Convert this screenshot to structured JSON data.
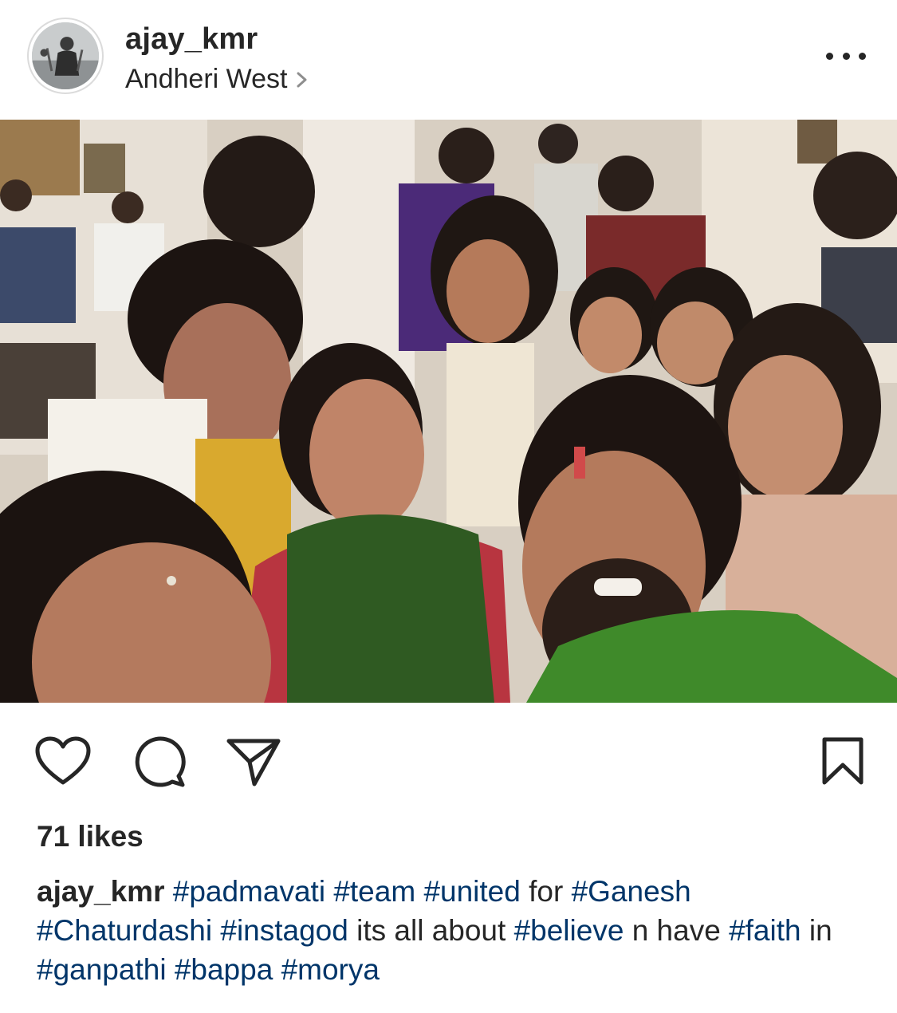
{
  "post": {
    "username": "ajay_kmr",
    "location": "Andheri West",
    "likes": "71 likes"
  },
  "caption": {
    "username": "ajay_kmr",
    "parts": [
      {
        "t": "#padmavati",
        "tag": true
      },
      {
        "t": " ",
        "tag": false
      },
      {
        "t": "#team",
        "tag": true
      },
      {
        "t": " ",
        "tag": false
      },
      {
        "t": "#united",
        "tag": true
      },
      {
        "t": " for ",
        "tag": false
      },
      {
        "t": "#Ganesh",
        "tag": true
      },
      {
        "t": " ",
        "tag": false
      },
      {
        "t": "#Chaturdashi",
        "tag": true
      },
      {
        "t": " ",
        "tag": false
      },
      {
        "t": "#instagod",
        "tag": true
      },
      {
        "t": " its all about ",
        "tag": false
      },
      {
        "t": "#believe",
        "tag": true
      },
      {
        "t": " n have ",
        "tag": false
      },
      {
        "t": "#faith",
        "tag": true
      },
      {
        "t": " in ",
        "tag": false
      },
      {
        "t": "#ganpathi",
        "tag": true
      },
      {
        "t": " ",
        "tag": false
      },
      {
        "t": "#bappa",
        "tag": true
      },
      {
        "t": " ",
        "tag": false
      },
      {
        "t": "#morya",
        "tag": true
      }
    ]
  },
  "icons": {
    "more": "more-options-icon",
    "like": "heart-icon",
    "comment": "comment-icon",
    "share": "paper-plane-icon",
    "save": "bookmark-icon",
    "location_chevron": "chevron-right-icon"
  },
  "colors": {
    "text": "#262626",
    "hashtag": "#003569",
    "divider": "#dbdbdb"
  }
}
